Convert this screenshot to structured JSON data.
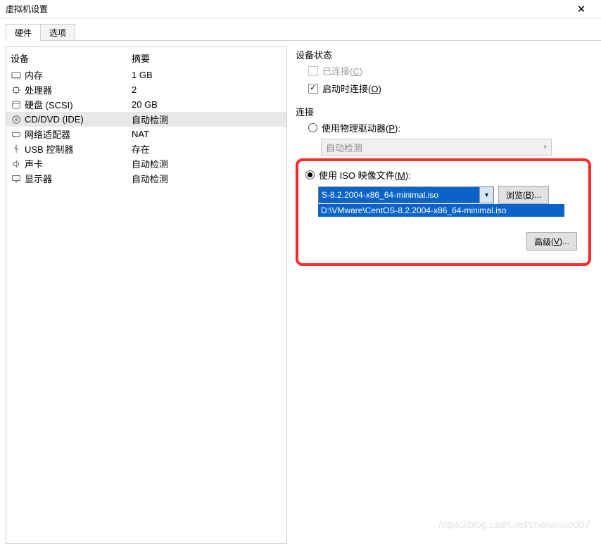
{
  "window": {
    "title": "虚拟机设置",
    "close": "✕"
  },
  "tabs": {
    "hardware": "硬件",
    "options": "选项"
  },
  "hw_header": {
    "device": "设备",
    "summary": "摘要"
  },
  "hw": [
    {
      "icon": "memory",
      "name": "内存",
      "summary": "1 GB"
    },
    {
      "icon": "cpu",
      "name": "处理器",
      "summary": "2"
    },
    {
      "icon": "hdd",
      "name": "硬盘 (SCSI)",
      "summary": "20 GB"
    },
    {
      "icon": "cd",
      "name": "CD/DVD (IDE)",
      "summary": "自动检测"
    },
    {
      "icon": "net",
      "name": "网络适配器",
      "summary": "NAT"
    },
    {
      "icon": "usb",
      "name": "USB 控制器",
      "summary": "存在"
    },
    {
      "icon": "sound",
      "name": "声卡",
      "summary": "自动检测"
    },
    {
      "icon": "display",
      "name": "显示器",
      "summary": "自动检测"
    }
  ],
  "status_group": {
    "title": "设备状态",
    "connected": "已连接",
    "connected_key": "C",
    "connect_at_pwr": "启动时连接",
    "connect_at_pwr_key": "O"
  },
  "conn_group": {
    "title": "连接",
    "use_physical": "使用物理驱动器",
    "use_physical_key": "P",
    "auto_detect": "自动检测",
    "use_iso": "使用 ISO 映像文件",
    "use_iso_key": "M",
    "iso_selected": "S-8.2.2004-x86_64-minimal.iso",
    "iso_path": "D:\\VMware\\CentOS-8.2.2004-x86_64-minimal.iso",
    "browse": "浏览",
    "browse_key": "B",
    "advanced": "高级",
    "advanced_key": "V"
  },
  "watermark": "https://blog.csdn.net/chenlixiao007"
}
